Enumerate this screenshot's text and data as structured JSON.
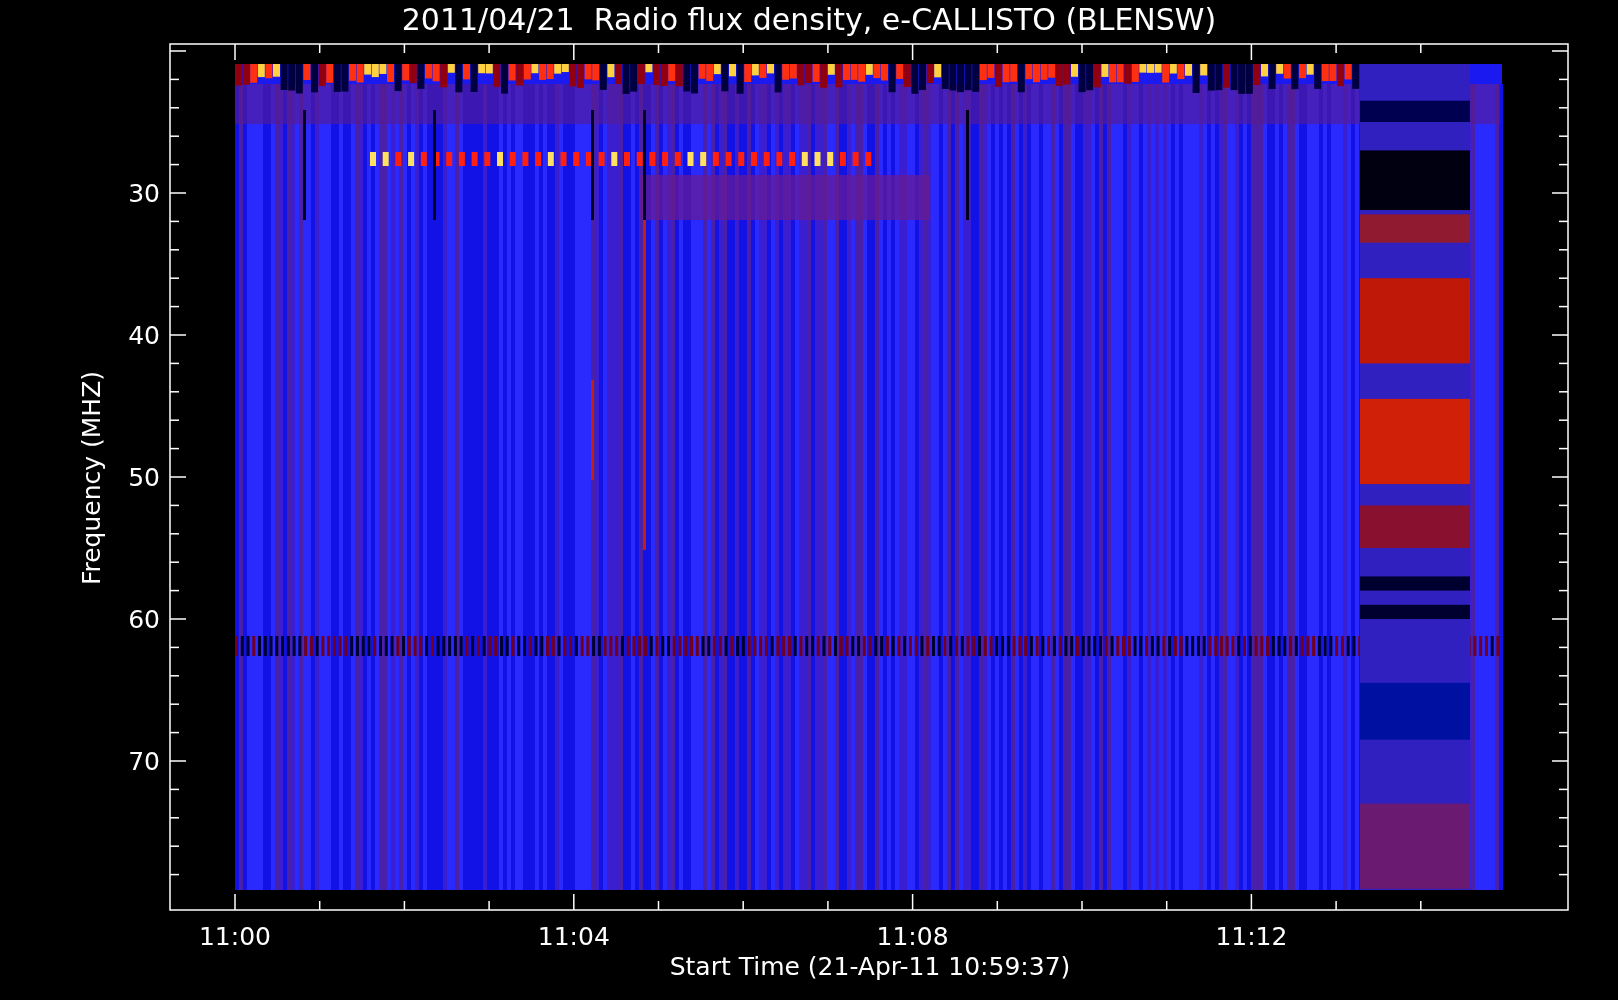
{
  "title": "2011/04/21  Radio flux density, e-CALLISTO (BLENSW)",
  "y_axis": {
    "label": "Frequency (MHZ)",
    "ticks": [
      "30",
      "40",
      "50",
      "60",
      "70"
    ]
  },
  "x_axis": {
    "label": "Start Time (21-Apr-11 10:59:37)",
    "ticks": [
      "11:00",
      "11:04",
      "11:08",
      "11:12"
    ]
  }
}
